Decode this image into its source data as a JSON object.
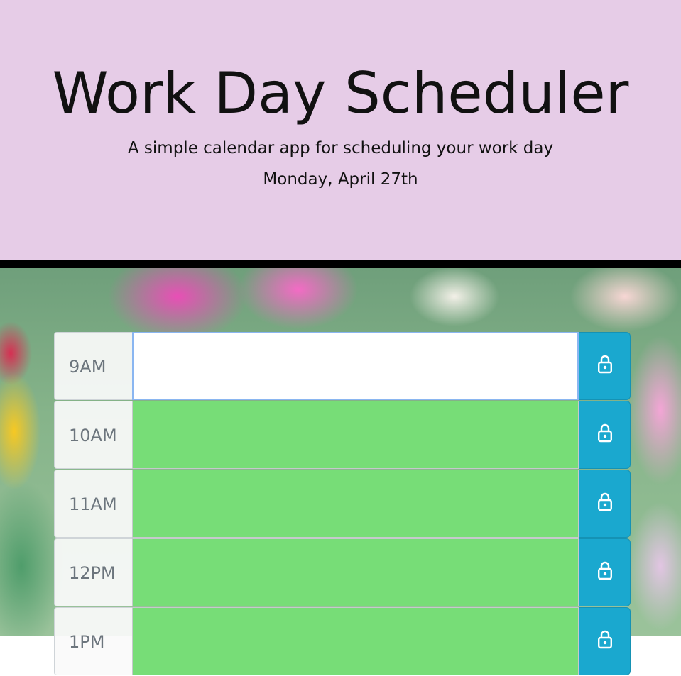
{
  "header": {
    "title": "Work Day Scheduler",
    "subtitle": "A simple calendar app for scheduling your work day",
    "current_day": "Monday, April 27th"
  },
  "colors": {
    "header_background": "#e6cce7",
    "present_row": "#ffffff",
    "future_row": "#77dd77",
    "save_button": "#1aa8cf"
  },
  "schedule": {
    "rows": [
      {
        "hour": "9AM",
        "state": "present",
        "task": "",
        "save_icon": "lock-icon"
      },
      {
        "hour": "10AM",
        "state": "future",
        "task": "",
        "save_icon": "lock-icon"
      },
      {
        "hour": "11AM",
        "state": "future",
        "task": "",
        "save_icon": "lock-icon"
      },
      {
        "hour": "12PM",
        "state": "future",
        "task": "",
        "save_icon": "lock-icon"
      },
      {
        "hour": "1PM",
        "state": "future",
        "task": "",
        "save_icon": "lock-icon"
      }
    ]
  }
}
